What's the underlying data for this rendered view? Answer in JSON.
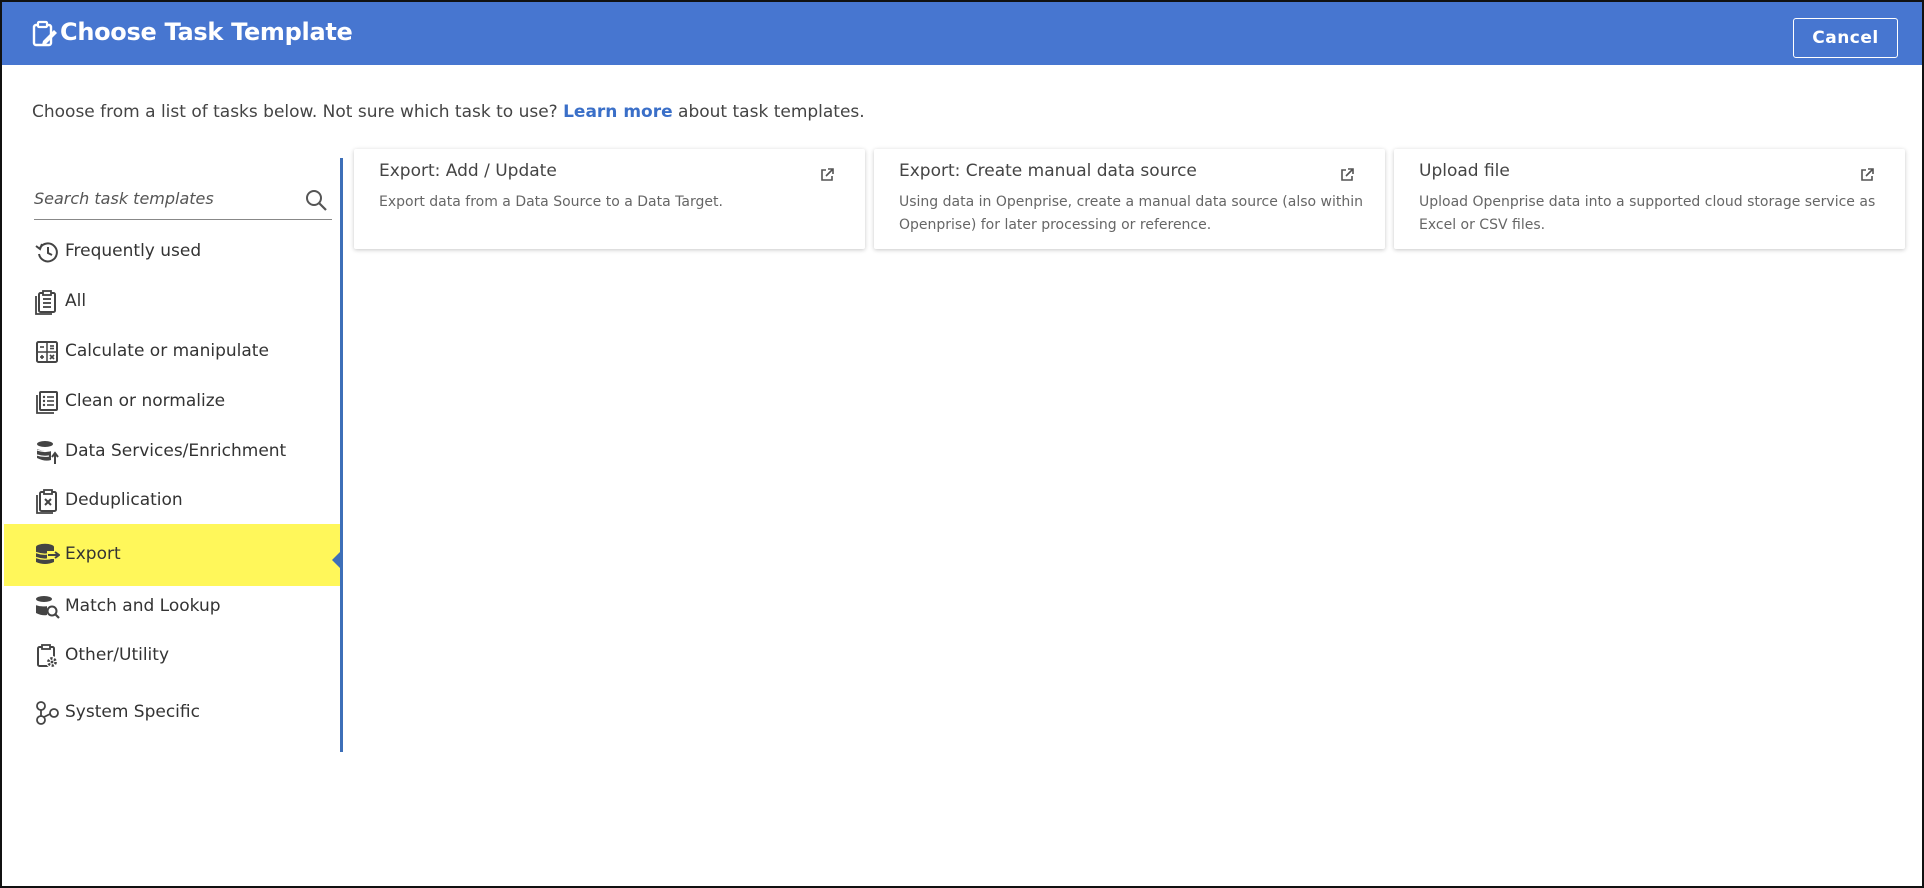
{
  "header": {
    "title": "Choose Task Template",
    "cancel_label": "Cancel",
    "title_icon": "clipboard-edit-icon"
  },
  "intro": {
    "text_before": "Choose from a list of tasks below. Not sure which task to use?",
    "link_text": "Learn more",
    "text_after": "about task templates."
  },
  "search": {
    "placeholder": "Search task templates",
    "value": ""
  },
  "sidebar": {
    "items": [
      {
        "label": "Frequently used",
        "icon": "history-icon"
      },
      {
        "label": "All",
        "icon": "clipboard-list-icon"
      },
      {
        "label": "Calculate or manipulate",
        "icon": "calculator-icon"
      },
      {
        "label": "Clean or normalize",
        "icon": "clean-list-icon"
      },
      {
        "label": "Data Services/Enrichment",
        "icon": "database-upload-icon"
      },
      {
        "label": "Deduplication",
        "icon": "clipboard-x-icon"
      },
      {
        "label": "Export",
        "icon": "database-export-icon",
        "active": true
      },
      {
        "label": "Match and Lookup",
        "icon": "database-search-icon"
      },
      {
        "label": "Other/Utility",
        "icon": "clipboard-gear-icon"
      },
      {
        "label": "System Specific",
        "icon": "nodes-icon"
      }
    ]
  },
  "cards": [
    {
      "title": "Export: Add / Update",
      "description": "Export data from a Data Source to a Data Target."
    },
    {
      "title": "Export: Create manual data source",
      "description": "Using data in Openprise, create a manual data source (also within Openprise) for later processing or reference."
    },
    {
      "title": "Upload file",
      "description": "Upload Openprise data into a supported cloud storage service as Excel or CSV files."
    }
  ],
  "colors": {
    "header_bg": "#4776d0",
    "active_bg": "#fff75a",
    "link": "#3a6fc8",
    "divider": "#3d6fb8"
  }
}
